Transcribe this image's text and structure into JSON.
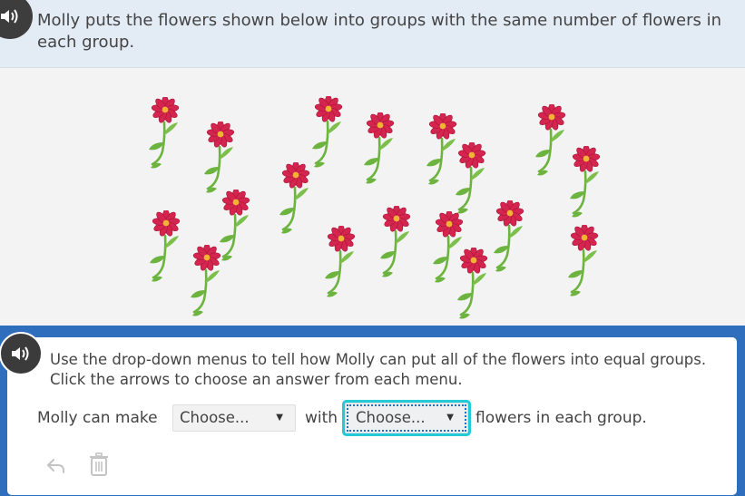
{
  "question": {
    "text": "Molly puts the flowers shown below into groups with the same number of flowers in each group."
  },
  "flowers": {
    "count": 18,
    "petal_color": "#d4254f",
    "center_color": "#f2b233",
    "stem_color": "#6db33f"
  },
  "answer": {
    "instructions": "Use the drop-down menus to tell how Molly can put all of the flowers into equal groups. Click the arrows to choose an answer from each menu.",
    "sentence_part1": "Molly can make",
    "dropdown1_value": "Choose...",
    "sentence_part2": "with",
    "dropdown2_value": "Choose...",
    "sentence_part3": "flowers in each group."
  },
  "toolbar": {
    "undo_icon": "undo-icon",
    "delete_icon": "trash-icon"
  },
  "icons": {
    "audio": "speaker-icon"
  },
  "colors": {
    "header_bg": "#e3ebf5",
    "band_blue": "#2f6dbd",
    "focus_cyan": "#22c9d6"
  }
}
